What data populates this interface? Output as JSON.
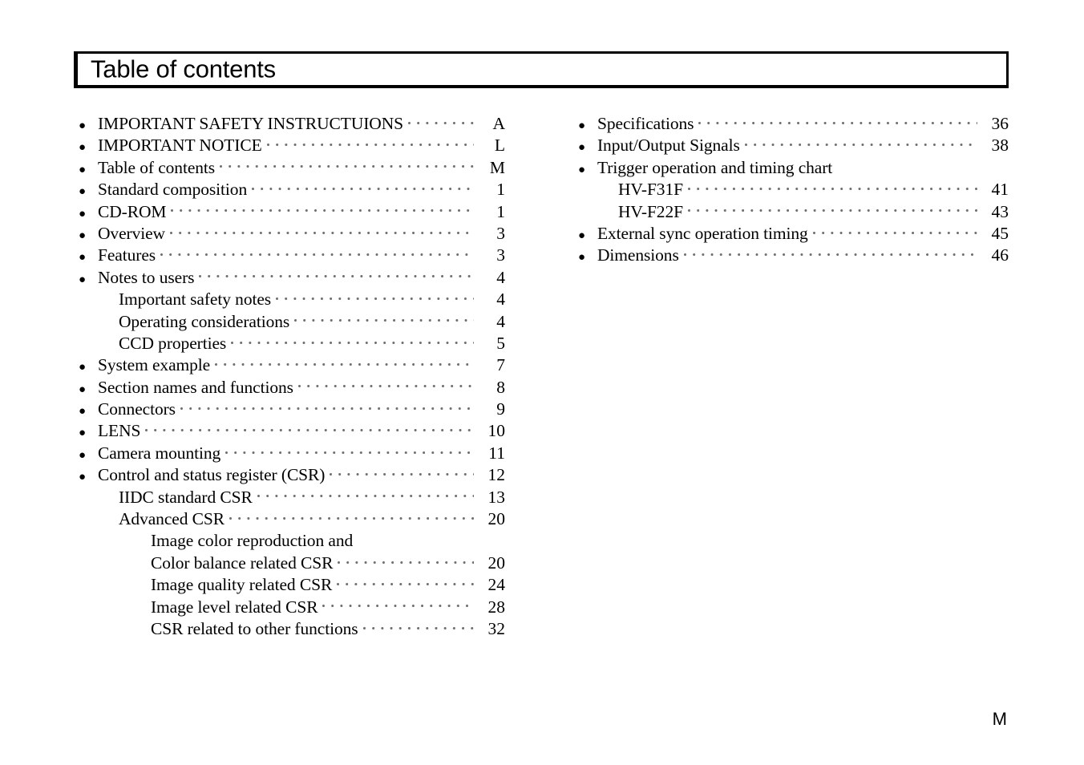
{
  "page": {
    "title": "Table of contents",
    "folio": "M",
    "bullet_glyph": "●",
    "background_color": "#ffffff",
    "text_color": "#000000",
    "leader_dot_color": "#6f6f6f"
  },
  "columns": {
    "left": [
      {
        "level": 0,
        "bullet": true,
        "label": "IMPORTANT SAFETY INSTRUCTUIONS",
        "page": "A",
        "leader": true
      },
      {
        "level": 0,
        "bullet": true,
        "label": "IMPORTANT NOTICE",
        "page": "L",
        "leader": true
      },
      {
        "level": 0,
        "bullet": true,
        "label": "Table of contents",
        "page": "M",
        "leader": true
      },
      {
        "level": 0,
        "bullet": true,
        "label": "Standard composition",
        "page": "1",
        "leader": true
      },
      {
        "level": 0,
        "bullet": true,
        "label": "CD-ROM",
        "page": "1",
        "leader": true
      },
      {
        "level": 0,
        "bullet": true,
        "label": "Overview",
        "page": "3",
        "leader": true
      },
      {
        "level": 0,
        "bullet": true,
        "label": "Features",
        "page": "3",
        "leader": true
      },
      {
        "level": 0,
        "bullet": true,
        "label": "Notes to users",
        "page": "4",
        "leader": true
      },
      {
        "level": 1,
        "bullet": false,
        "label": "Important safety notes",
        "page": "4",
        "leader": true
      },
      {
        "level": 1,
        "bullet": false,
        "label": "Operating considerations",
        "page": "4",
        "leader": true
      },
      {
        "level": 1,
        "bullet": false,
        "label": "CCD properties",
        "page": "5",
        "leader": true
      },
      {
        "level": 0,
        "bullet": true,
        "label": "System example",
        "page": "7",
        "leader": true
      },
      {
        "level": 0,
        "bullet": true,
        "label": "Section names and functions",
        "page": "8",
        "leader": true
      },
      {
        "level": 0,
        "bullet": true,
        "label": "Connectors",
        "page": "9",
        "leader": true
      },
      {
        "level": 0,
        "bullet": true,
        "label": "LENS",
        "page": "10",
        "leader": true
      },
      {
        "level": 0,
        "bullet": true,
        "label": "Camera mounting",
        "page": "11",
        "leader": true
      },
      {
        "level": 0,
        "bullet": true,
        "label": "Control and status register (CSR)",
        "page": "12",
        "leader": true
      },
      {
        "level": 1,
        "bullet": false,
        "label": "IIDC standard CSR",
        "page": "13",
        "leader": true
      },
      {
        "level": 1,
        "bullet": false,
        "label": "Advanced CSR",
        "page": "20",
        "leader": true
      },
      {
        "level": 2,
        "bullet": false,
        "label": "Image color reproduction and",
        "page": "",
        "leader": false
      },
      {
        "level": 2,
        "bullet": false,
        "label": "Color balance related CSR",
        "page": "20",
        "leader": true
      },
      {
        "level": 2,
        "bullet": false,
        "label": "Image quality related CSR",
        "page": "24",
        "leader": true
      },
      {
        "level": 2,
        "bullet": false,
        "label": "Image level related CSR",
        "page": "28",
        "leader": true
      },
      {
        "level": 2,
        "bullet": false,
        "label": "CSR related to other functions",
        "page": "32",
        "leader": true
      }
    ],
    "right": [
      {
        "level": 0,
        "bullet": true,
        "label": "Specifications",
        "page": "36",
        "leader": true
      },
      {
        "level": 0,
        "bullet": true,
        "label": "Input/Output Signals",
        "page": "38",
        "leader": true
      },
      {
        "level": 0,
        "bullet": true,
        "label": "Trigger operation and timing chart",
        "page": "",
        "leader": false
      },
      {
        "level": 1,
        "bullet": false,
        "label": "HV-F31F",
        "page": "41",
        "leader": true
      },
      {
        "level": 1,
        "bullet": false,
        "label": "HV-F22F",
        "page": "43",
        "leader": true
      },
      {
        "level": 0,
        "bullet": true,
        "label": "External sync operation timing",
        "page": "45",
        "leader": true
      },
      {
        "level": 0,
        "bullet": true,
        "label": "Dimensions",
        "page": "46",
        "leader": true
      }
    ]
  }
}
